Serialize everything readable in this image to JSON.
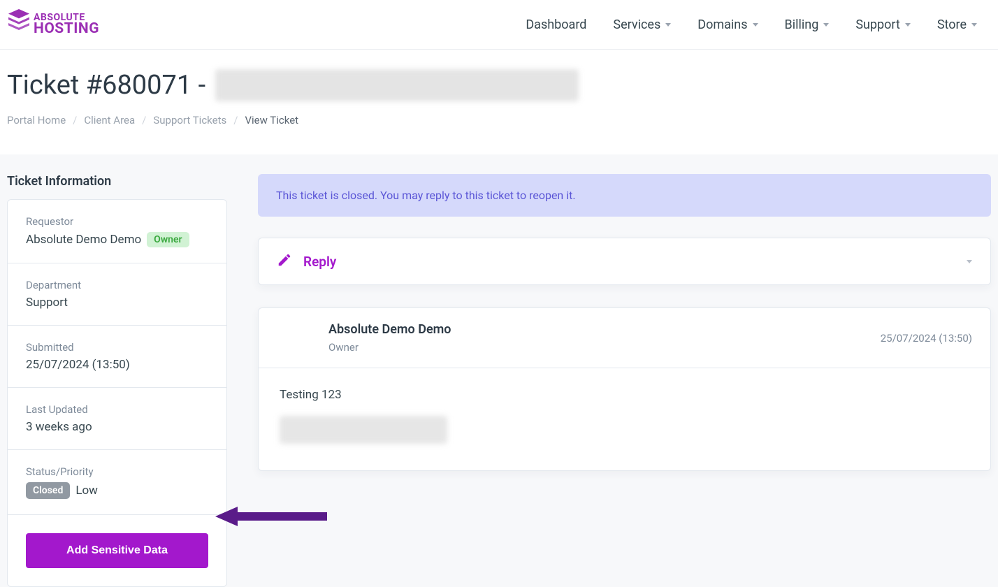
{
  "brand": {
    "top": "ABSOLUTE",
    "bottom": "HOSTING"
  },
  "nav": {
    "dashboard": "Dashboard",
    "services": "Services",
    "domains": "Domains",
    "billing": "Billing",
    "support": "Support",
    "store": "Store"
  },
  "page": {
    "title_prefix": "Ticket #680071 - "
  },
  "breadcrumb": {
    "portal_home": "Portal Home",
    "client_area": "Client Area",
    "support_tickets": "Support Tickets",
    "view_ticket": "View Ticket"
  },
  "sidebar": {
    "heading": "Ticket Information",
    "requestor_label": "Requestor",
    "requestor_value": "Absolute Demo Demo",
    "owner_badge": "Owner",
    "department_label": "Department",
    "department_value": "Support",
    "submitted_label": "Submitted",
    "submitted_value": "25/07/2024 (13:50)",
    "last_updated_label": "Last Updated",
    "last_updated_value": "3 weeks ago",
    "status_label": "Status/Priority",
    "status_badge": "Closed",
    "priority_value": "Low",
    "add_sensitive_btn": "Add Sensitive Data"
  },
  "alert": {
    "text": "This ticket is closed. You may reply to this ticket to reopen it."
  },
  "reply": {
    "label": "Reply"
  },
  "message": {
    "author": "Absolute Demo Demo",
    "role": "Owner",
    "datetime": "25/07/2024 (13:50)",
    "body_line": "Testing 123"
  }
}
